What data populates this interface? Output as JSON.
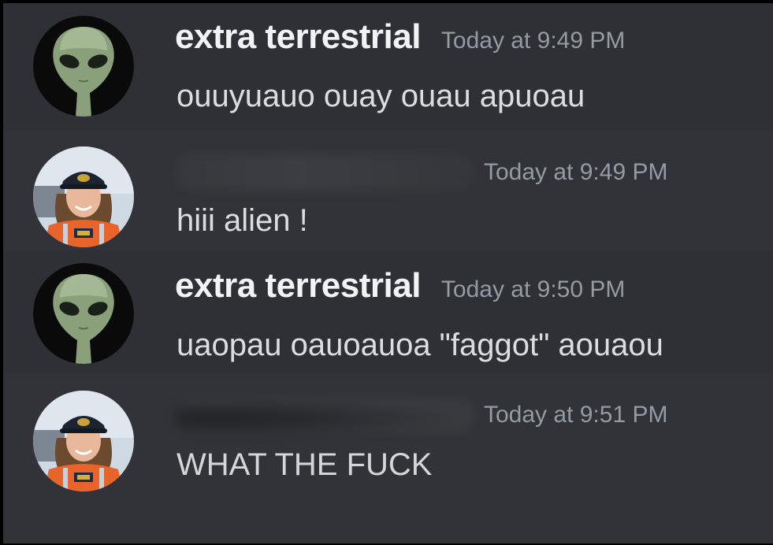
{
  "messages": [
    {
      "username": "extra terrestrial",
      "timestamp": "Today at 9:49 PM",
      "content": "ouuyuauo ouay ouau apuoau",
      "avatar_icon": "alien-avatar-icon",
      "username_redacted": false
    },
    {
      "username": "",
      "timestamp": "Today at 9:49 PM",
      "content": "hiii alien !",
      "avatar_icon": "astronaut-avatar-icon",
      "username_redacted": true
    },
    {
      "username": "extra terrestrial",
      "timestamp": "Today at 9:50 PM",
      "content": "uaopau oauoauoa \"faggot\" aouaou",
      "avatar_icon": "alien-avatar-icon",
      "username_redacted": false
    },
    {
      "username": "",
      "timestamp": "Today at 9:51 PM",
      "content": "WHAT THE FUCK",
      "avatar_icon": "astronaut-avatar-icon",
      "username_redacted": true
    }
  ],
  "colors": {
    "background": "#313338",
    "username": "#f2f3f5",
    "timestamp": "#949ba4",
    "message_text": "#dbdee1"
  }
}
